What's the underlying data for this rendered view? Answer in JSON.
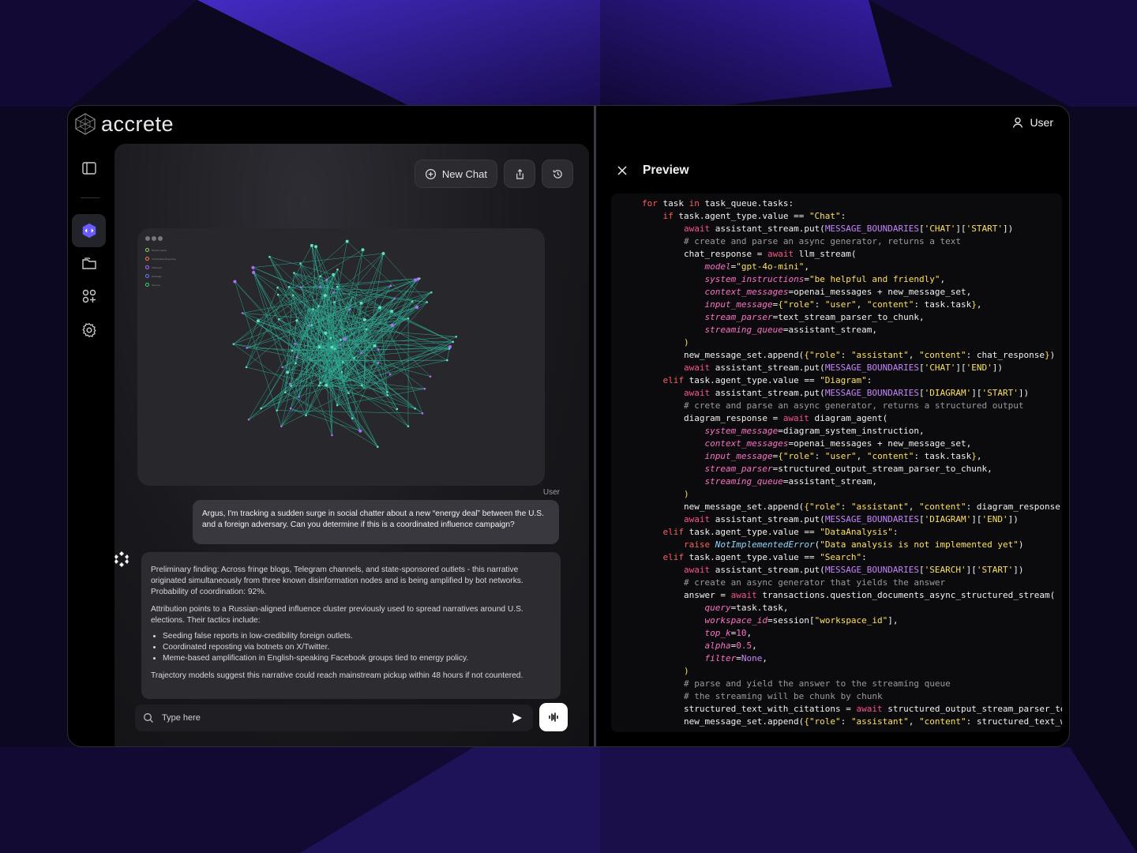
{
  "app": {
    "brand": "accrete"
  },
  "header": {
    "user_label": "User"
  },
  "chat": {
    "new_chat_label": "New Chat",
    "graph_legend": [
      {
        "label": "Disinformation",
        "color": "#8bd65a"
      },
      {
        "label": "Coordinated Reposting",
        "color": "#ff7a4a"
      },
      {
        "label": "Influencer",
        "color": "#b469ff"
      },
      {
        "label": "Hashtags",
        "color": "#6b7cff"
      },
      {
        "label": "Sources",
        "color": "#3ad86b"
      }
    ],
    "user_label": "User",
    "user_message": "Argus, I'm tracking a sudden surge in social chatter about a new “energy deal” between the U.S. and a foreign adversary. Can you determine if this is a coordinated influence campaign?",
    "bot_paragraph_1": "Preliminary finding: Across fringe blogs, Telegram channels, and state-sponsored outlets -  this narrative originated simultaneously from three known disinformation nodes and is being amplified by bot networks. Probability of coordination: 92%.",
    "bot_paragraph_2": "Attribution points to a Russian-aligned influence cluster previously used to spread narratives around U.S. elections. Their tactics include:",
    "bot_bullets": [
      "Seeding false reports in low-credibility foreign outlets.",
      "Coordinated reposting via botnets on X/Twitter.",
      "Meme-based amplification in English-speaking Facebook groups tied to energy policy."
    ],
    "bot_paragraph_3": "Trajectory models suggest this narrative could reach mainstream pickup within 48 hours if not countered.",
    "input_placeholder": "Type here"
  },
  "preview": {
    "title": "Preview",
    "code_lines": [
      [
        [
          "for",
          "kw"
        ],
        [
          " task "
        ],
        [
          "in",
          "kw"
        ],
        [
          " task_queue.tasks:"
        ]
      ],
      [
        [
          "    "
        ],
        [
          "if",
          "kw"
        ],
        [
          " task.agent_type.value == "
        ],
        [
          "\"Chat\"",
          "str"
        ],
        [
          ":"
        ]
      ],
      [
        [
          "        "
        ],
        [
          "await",
          "kw2"
        ],
        [
          " assistant_stream.put("
        ],
        [
          "MESSAGE_BOUNDARIES",
          "cn"
        ],
        [
          "["
        ],
        [
          "'CHAT'",
          "str"
        ],
        [
          "]["
        ],
        [
          "'START'",
          "str"
        ],
        [
          "])"
        ]
      ],
      [
        [
          "        "
        ],
        [
          "# create and parse an async generator, returns a text",
          "cm"
        ]
      ],
      [
        [
          "        chat_response = "
        ],
        [
          "await",
          "kw2"
        ],
        [
          " llm_stream("
        ]
      ],
      [
        [
          "            "
        ],
        [
          "model",
          "pm"
        ],
        [
          "="
        ],
        [
          "\"gpt-4o-mini\"",
          "str"
        ],
        [
          ","
        ]
      ],
      [
        [
          "            "
        ],
        [
          "system_instructions",
          "pm"
        ],
        [
          "="
        ],
        [
          "\"be helpful and friendly\"",
          "str"
        ],
        [
          ","
        ]
      ],
      [
        [
          "            "
        ],
        [
          "context_messages",
          "pm"
        ],
        [
          "=openai_messages + new_message_set,"
        ]
      ],
      [
        [
          "            "
        ],
        [
          "input_message",
          "pm"
        ],
        [
          "="
        ],
        [
          "{",
          "br"
        ],
        [
          "\"role\"",
          "str"
        ],
        [
          ": "
        ],
        [
          "\"user\"",
          "str"
        ],
        [
          ", "
        ],
        [
          "\"content\"",
          "str"
        ],
        [
          ": task.task"
        ],
        [
          "}",
          "br"
        ],
        [
          ","
        ]
      ],
      [
        [
          "            "
        ],
        [
          "stream_parser",
          "pm"
        ],
        [
          "=text_stream_parser_to_chunk,"
        ]
      ],
      [
        [
          "            "
        ],
        [
          "streaming_queue",
          "pm"
        ],
        [
          "=assistant_stream,"
        ]
      ],
      [
        [
          "        "
        ],
        [
          ")",
          "br"
        ]
      ],
      [
        [
          "        new_message_set.append("
        ],
        [
          "{",
          "br"
        ],
        [
          "\"role\"",
          "str"
        ],
        [
          ": "
        ],
        [
          "\"assistant\"",
          "str"
        ],
        [
          ", "
        ],
        [
          "\"content\"",
          "str"
        ],
        [
          ": chat_response"
        ],
        [
          "}",
          "br"
        ],
        [
          ")"
        ]
      ],
      [
        [
          "        "
        ],
        [
          "await",
          "kw2"
        ],
        [
          " assistant_stream.put("
        ],
        [
          "MESSAGE_BOUNDARIES",
          "cn"
        ],
        [
          "["
        ],
        [
          "'CHAT'",
          "str"
        ],
        [
          "]["
        ],
        [
          "'END'",
          "str"
        ],
        [
          "])"
        ]
      ],
      [
        [
          "    "
        ],
        [
          "elif",
          "kw"
        ],
        [
          " task.agent_type.value == "
        ],
        [
          "\"Diagram\"",
          "str"
        ],
        [
          ":"
        ]
      ],
      [
        [
          "        "
        ],
        [
          "await",
          "kw2"
        ],
        [
          " assistant_stream.put("
        ],
        [
          "MESSAGE_BOUNDARIES",
          "cn"
        ],
        [
          "["
        ],
        [
          "'DIAGRAM'",
          "str"
        ],
        [
          "]["
        ],
        [
          "'START'",
          "str"
        ],
        [
          "])"
        ]
      ],
      [
        [
          "        "
        ],
        [
          "# crete and parse an async generator, returns a structured output",
          "cm"
        ]
      ],
      [
        [
          "        diagram_response = "
        ],
        [
          "await",
          "kw2"
        ],
        [
          " diagram_agent("
        ]
      ],
      [
        [
          "            "
        ],
        [
          "system_message",
          "pm"
        ],
        [
          "=diagram_system_instruction,"
        ]
      ],
      [
        [
          "            "
        ],
        [
          "context_messages",
          "pm"
        ],
        [
          "=openai_messages + new_message_set,"
        ]
      ],
      [
        [
          "            "
        ],
        [
          "input_message",
          "pm"
        ],
        [
          "="
        ],
        [
          "{",
          "br"
        ],
        [
          "\"role\"",
          "str"
        ],
        [
          ": "
        ],
        [
          "\"user\"",
          "str"
        ],
        [
          ", "
        ],
        [
          "\"content\"",
          "str"
        ],
        [
          ": task.task"
        ],
        [
          "}",
          "br"
        ],
        [
          ","
        ]
      ],
      [
        [
          "            "
        ],
        [
          "stream_parser",
          "pm"
        ],
        [
          "=structured_output_stream_parser_to_chunk,"
        ]
      ],
      [
        [
          "            "
        ],
        [
          "streaming_queue",
          "pm"
        ],
        [
          "=assistant_stream,"
        ]
      ],
      [
        [
          "        "
        ],
        [
          ")",
          "br"
        ]
      ],
      [
        [
          "        new_message_set.append("
        ],
        [
          "{",
          "br"
        ],
        [
          "\"role\"",
          "str"
        ],
        [
          ": "
        ],
        [
          "\"assistant\"",
          "str"
        ],
        [
          ", "
        ],
        [
          "\"content\"",
          "str"
        ],
        [
          ": diagram_response.mo"
        ]
      ],
      [
        [
          "        "
        ],
        [
          "await",
          "kw2"
        ],
        [
          " assistant_stream.put("
        ],
        [
          "MESSAGE_BOUNDARIES",
          "cn"
        ],
        [
          "["
        ],
        [
          "'DIAGRAM'",
          "str"
        ],
        [
          "]["
        ],
        [
          "'END'",
          "str"
        ],
        [
          "])"
        ]
      ],
      [
        [
          "    "
        ],
        [
          "elif",
          "kw"
        ],
        [
          " task.agent_type.value == "
        ],
        [
          "\"DataAnalysis\"",
          "str"
        ],
        [
          ":"
        ]
      ],
      [
        [
          "        "
        ],
        [
          "raise",
          "kw"
        ],
        [
          " "
        ],
        [
          "NotImplementedError",
          "exc"
        ],
        [
          "("
        ],
        [
          "\"Data analysis is not implemented yet\"",
          "str"
        ],
        [
          ")"
        ]
      ],
      [
        [
          "    "
        ],
        [
          "elif",
          "kw"
        ],
        [
          " task.agent_type.value == "
        ],
        [
          "\"Search\"",
          "str"
        ],
        [
          ":"
        ]
      ],
      [
        [
          "        "
        ],
        [
          "await",
          "kw2"
        ],
        [
          " assistant_stream.put("
        ],
        [
          "MESSAGE_BOUNDARIES",
          "cn"
        ],
        [
          "["
        ],
        [
          "'SEARCH'",
          "str"
        ],
        [
          "]["
        ],
        [
          "'START'",
          "str"
        ],
        [
          "])"
        ]
      ],
      [
        [
          "        "
        ],
        [
          "# create an async generator that yields the answer",
          "cm"
        ]
      ],
      [
        [
          "        answer = "
        ],
        [
          "await",
          "kw2"
        ],
        [
          " transactions.question_documents_async_structured_stream("
        ]
      ],
      [
        [
          "            "
        ],
        [
          "query",
          "pm"
        ],
        [
          "=task.task,"
        ]
      ],
      [
        [
          "            "
        ],
        [
          "workspace_id",
          "pm"
        ],
        [
          "=session["
        ],
        [
          "\"workspace_id\"",
          "str"
        ],
        [
          "],"
        ]
      ],
      [
        [
          "            "
        ],
        [
          "top_k",
          "pm"
        ],
        [
          "="
        ],
        [
          "10",
          "num"
        ],
        [
          ","
        ]
      ],
      [
        [
          "            "
        ],
        [
          "alpha",
          "pm"
        ],
        [
          "="
        ],
        [
          "0.5",
          "num"
        ],
        [
          ","
        ]
      ],
      [
        [
          "            "
        ],
        [
          "filter",
          "pm"
        ],
        [
          "="
        ],
        [
          "None",
          "none"
        ],
        [
          ","
        ]
      ],
      [
        [
          "        "
        ],
        [
          ")",
          "br"
        ]
      ],
      [
        [
          "        "
        ],
        [
          "# parse and yield the answer to the streaming queue",
          "cm"
        ]
      ],
      [
        [
          "        "
        ],
        [
          "# the streaming will be chunk by chunk",
          "cm"
        ]
      ],
      [
        [
          "        structured_text_with_citations = "
        ],
        [
          "await",
          "kw2"
        ],
        [
          " structured_output_stream_parser_to_c"
        ]
      ],
      [
        [
          "        new_message_set.append("
        ],
        [
          "{",
          "br"
        ],
        [
          "\"role\"",
          "str"
        ],
        [
          ": "
        ],
        [
          "\"assistant\"",
          "str"
        ],
        [
          ", "
        ],
        [
          "\"content\"",
          "str"
        ],
        [
          ": structured_text_wit"
        ]
      ]
    ]
  },
  "colors": {
    "accent": "#6a5cff",
    "background": "#0d0822",
    "graph_edge": "#2fd4b4",
    "graph_node": "#b469ff"
  }
}
